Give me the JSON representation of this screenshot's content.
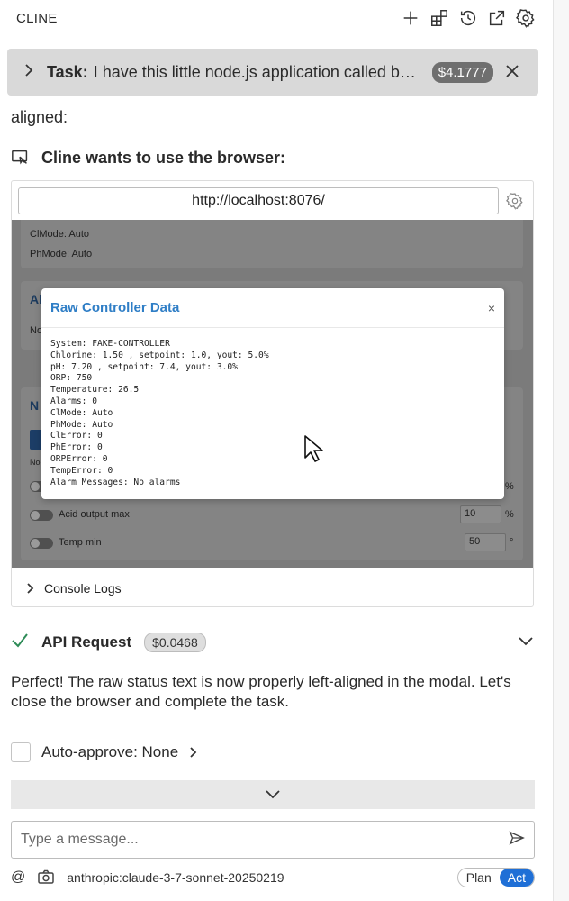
{
  "header": {
    "title": "CLINE",
    "icons": [
      "plus-icon",
      "extensions-icon",
      "history-icon",
      "popout-icon",
      "gear-icon"
    ]
  },
  "task": {
    "label": "Task:",
    "text": "I have this little node.js application called bs...",
    "cost": "$4.1777"
  },
  "partial_text": "aligned:",
  "browser": {
    "heading": "Cline wants to use the browser:",
    "url": "http://localhost:8076/",
    "screenshot": {
      "line1": "ClMode: Auto",
      "line2": "PhMode: Auto",
      "section_a": "Al",
      "section_a_text": "No",
      "section_n": "N",
      "small_text": "No",
      "row_acid_label": "Acid output max",
      "row_acid_value": "10",
      "row_acid_unit": "%",
      "row_top_unit": "%",
      "row_temp_label": "Temp min",
      "row_temp_value": "50",
      "row_temp_unit": "°"
    },
    "modal": {
      "title": "Raw Controller Data",
      "close": "×",
      "lines": [
        "System: FAKE-CONTROLLER",
        "Chlorine: 1.50 , setpoint: 1.0, yout: 5.0%",
        "pH: 7.20 , setpoint: 7.4, yout: 3.0%",
        "ORP: 750",
        "Temperature: 26.5",
        "Alarms: 0",
        "ClMode: Auto",
        "PhMode: Auto",
        "ClError: 0",
        "PhError: 0",
        "ORPError: 0",
        "TempError: 0",
        "Alarm Messages: No alarms"
      ]
    },
    "console_label": "Console Logs"
  },
  "api": {
    "label": "API Request",
    "cost": "$0.0468"
  },
  "message": "Perfect! The raw status text is now properly left-aligned in the modal. Let's close the browser and complete the task.",
  "auto_approve": "Auto-approve: None",
  "input": {
    "placeholder": "Type a message..."
  },
  "footer": {
    "at": "@",
    "model": "anthropic:claude-3-7-sonnet-20250219",
    "plan": "Plan",
    "act": "Act"
  },
  "colors": {
    "accent": "#1f6fd6",
    "success": "#2e8b57",
    "modal_title": "#2f7ec6"
  }
}
